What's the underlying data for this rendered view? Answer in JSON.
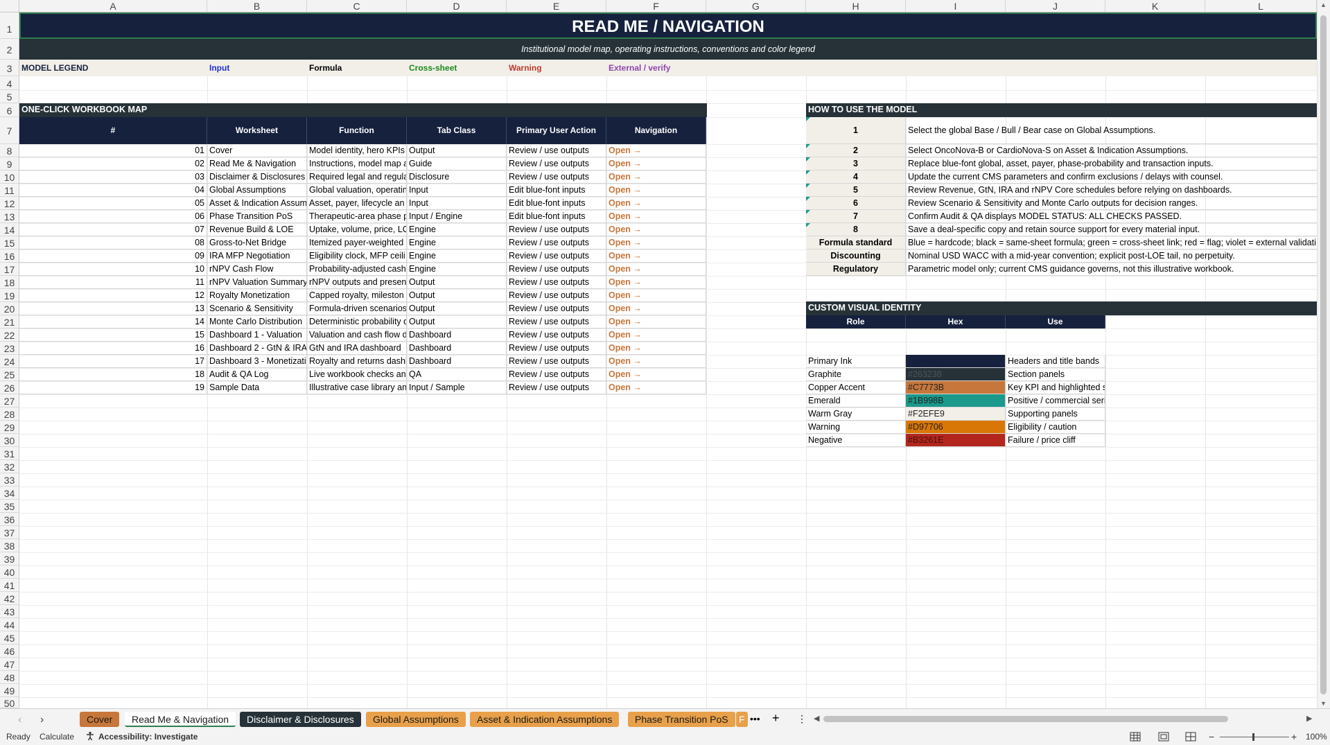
{
  "columns": [
    "A",
    "B",
    "C",
    "D",
    "E",
    "F",
    "G",
    "H",
    "I",
    "J",
    "K",
    "L"
  ],
  "rows": [
    "1",
    "2",
    "3",
    "4",
    "5",
    "6",
    "7",
    "8",
    "9",
    "10",
    "11",
    "12",
    "13",
    "14",
    "15",
    "16",
    "17",
    "18",
    "19",
    "20",
    "21",
    "22",
    "23",
    "24",
    "25",
    "26",
    "27",
    "28",
    "29",
    "30",
    "31",
    "32",
    "33",
    "34",
    "35",
    "36",
    "37",
    "38",
    "39",
    "40",
    "41",
    "42",
    "43",
    "44",
    "45",
    "46",
    "47",
    "48",
    "49",
    "50"
  ],
  "title": "READ ME / NAVIGATION",
  "subtitle": "Institutional model map, operating instructions, conventions and color legend",
  "legend": {
    "label": "MODEL LEGEND",
    "input": "Input",
    "formula": "Formula",
    "cross_sheet": "Cross-sheet",
    "warning": "Warning",
    "external": "External / verify",
    "colors": {
      "input": "#1f2fd1",
      "formula": "#000000",
      "cross_sheet": "#1a8a1a",
      "warning": "#c0392b",
      "external": "#8e44ad"
    }
  },
  "map": {
    "section_title": "ONE-CLICK WORKBOOK MAP",
    "headers": [
      "#",
      "Worksheet",
      "Function",
      "Tab Class",
      "Primary User Action",
      "Navigation"
    ],
    "rows": [
      {
        "n": "01",
        "sheet": "Cover",
        "func": "Model identity, hero KPIs",
        "cls": "Output",
        "action": "Review / use outputs",
        "nav": "Open →"
      },
      {
        "n": "02",
        "sheet": "Read Me & Navigation",
        "func": "Instructions, model map a",
        "cls": "Guide",
        "action": "Review / use outputs",
        "nav": "Open →"
      },
      {
        "n": "03",
        "sheet": "Disclaimer & Disclosures",
        "func": "Required legal and regula",
        "cls": "Disclosure",
        "action": "Review / use outputs",
        "nav": "Open →"
      },
      {
        "n": "04",
        "sheet": "Global Assumptions",
        "func": "Global valuation, operatin",
        "cls": "Input",
        "action": "Edit blue-font inputs",
        "nav": "Open →"
      },
      {
        "n": "05",
        "sheet": "Asset & Indication Assum",
        "func": "Asset, payer, lifecycle an",
        "cls": "Input",
        "action": "Edit blue-font inputs",
        "nav": "Open →"
      },
      {
        "n": "06",
        "sheet": "Phase Transition PoS",
        "func": "Therapeutic-area phase p",
        "cls": "Input / Engine",
        "action": "Edit blue-font inputs",
        "nav": "Open →"
      },
      {
        "n": "07",
        "sheet": "Revenue Build & LOE",
        "func": "Uptake, volume, price, LC",
        "cls": "Engine",
        "action": "Review / use outputs",
        "nav": "Open →"
      },
      {
        "n": "08",
        "sheet": "Gross-to-Net Bridge",
        "func": "Itemized payer-weighted g",
        "cls": "Engine",
        "action": "Review / use outputs",
        "nav": "Open →"
      },
      {
        "n": "09",
        "sheet": "IRA MFP Negotiation",
        "func": "Eligibility clock, MFP ceili",
        "cls": "Engine",
        "action": "Review / use outputs",
        "nav": "Open →"
      },
      {
        "n": "10",
        "sheet": "rNPV Cash Flow",
        "func": "Probability-adjusted cash",
        "cls": "Engine",
        "action": "Review / use outputs",
        "nav": "Open →"
      },
      {
        "n": "11",
        "sheet": "rNPV Valuation Summary",
        "func": "rNPV outputs and presen",
        "cls": "Output",
        "action": "Review / use outputs",
        "nav": "Open →"
      },
      {
        "n": "12",
        "sheet": "Royalty Monetization",
        "func": "Capped royalty, mileston",
        "cls": "Output",
        "action": "Review / use outputs",
        "nav": "Open →"
      },
      {
        "n": "13",
        "sheet": "Scenario & Sensitivity",
        "func": "Formula-driven scenarios",
        "cls": "Output",
        "action": "Review / use outputs",
        "nav": "Open →"
      },
      {
        "n": "14",
        "sheet": "Monte Carlo Distribution",
        "func": "Deterministic probability d",
        "cls": "Output",
        "action": "Review / use outputs",
        "nav": "Open →"
      },
      {
        "n": "15",
        "sheet": "Dashboard 1 - Valuation",
        "func": "Valuation and cash flow d",
        "cls": "Dashboard",
        "action": "Review / use outputs",
        "nav": "Open →"
      },
      {
        "n": "16",
        "sheet": "Dashboard 2 - GtN & IRA",
        "func": "GtN and IRA dashboard",
        "cls": "Dashboard",
        "action": "Review / use outputs",
        "nav": "Open →"
      },
      {
        "n": "17",
        "sheet": "Dashboard 3 - Monetizati",
        "func": "Royalty and returns dashb",
        "cls": "Dashboard",
        "action": "Review / use outputs",
        "nav": "Open →"
      },
      {
        "n": "18",
        "sheet": "Audit & QA Log",
        "func": "Live workbook checks an",
        "cls": "QA",
        "action": "Review / use outputs",
        "nav": "Open →"
      },
      {
        "n": "19",
        "sheet": "Sample Data",
        "func": "Illustrative case library an",
        "cls": "Input / Sample",
        "action": "Review / use outputs",
        "nav": "Open →"
      }
    ]
  },
  "how_to": {
    "section_title": "HOW TO USE THE MODEL",
    "steps": [
      {
        "k": "1",
        "text": "Select the global Base / Bull / Bear case on Global Assumptions."
      },
      {
        "k": "2",
        "text": "Select OncoNova-B or CardioNova-S on Asset & Indication Assumptions."
      },
      {
        "k": "3",
        "text": "Replace blue-font global, asset, payer, phase-probability and transaction inputs."
      },
      {
        "k": "4",
        "text": "Update the current CMS parameters and confirm exclusions / delays with counsel."
      },
      {
        "k": "5",
        "text": "Review Revenue, GtN, IRA and rNPV Core schedules before relying on dashboards."
      },
      {
        "k": "6",
        "text": "Review Scenario & Sensitivity and Monte Carlo outputs for decision ranges."
      },
      {
        "k": "7",
        "text": "Confirm Audit & QA displays MODEL STATUS: ALL CHECKS PASSED."
      },
      {
        "k": "8",
        "text": "Save a deal-specific copy and retain source support for every material input."
      },
      {
        "k": "Formula standard",
        "text": "Blue = hardcode; black = same-sheet formula; green = cross-sheet link; red = flag; violet = external validati"
      },
      {
        "k": "Discounting",
        "text": "Nominal USD WACC with a mid-year convention; explicit post-LOE tail, no perpetuity."
      },
      {
        "k": "Regulatory",
        "text": "Parametric model only; current CMS guidance governs, not this illustrative workbook."
      }
    ]
  },
  "identity": {
    "section_title": "CUSTOM VISUAL IDENTITY",
    "headers": [
      "Role",
      "Hex",
      "Use"
    ],
    "rows": [
      {
        "role": "Primary Ink",
        "hex": "#16213E",
        "use": "Headers and title bands",
        "color": "#16213e",
        "fg": "#16213e"
      },
      {
        "role": "Graphite",
        "hex": "#263238",
        "use": "Section panels",
        "color": "#263238",
        "fg": "#4a565c"
      },
      {
        "role": "Copper Accent",
        "hex": "#C7773B",
        "use": "Key KPI and highlighted series",
        "color": "#c7773b",
        "fg": "#222222"
      },
      {
        "role": "Emerald",
        "hex": "#1B998B",
        "use": "Positive / commercial series",
        "color": "#1b998b",
        "fg": "#222222"
      },
      {
        "role": "Warm Gray",
        "hex": "#F2EFE9",
        "use": "Supporting panels",
        "color": "#f2efe9",
        "fg": "#222222"
      },
      {
        "role": "Warning",
        "hex": "#D97706",
        "use": "Eligibility / caution",
        "color": "#d97706",
        "fg": "#222222"
      },
      {
        "role": "Negative",
        "hex": "#B3261E",
        "use": "Failure / price cliff",
        "color": "#b3261e",
        "fg": "#4a0f0c"
      }
    ]
  },
  "tabs": [
    {
      "label": "Cover",
      "bg": "#c7773b",
      "fg": "#1a1a1a",
      "active": false
    },
    {
      "label": "Read Me & Navigation",
      "bg": "#ffffff",
      "fg": "#1a1a1a",
      "active": true
    },
    {
      "label": "Disclaimer & Disclosures",
      "bg": "#263238",
      "fg": "#ffffff",
      "active": false
    },
    {
      "label": "Global Assumptions",
      "bg": "#e8a04a",
      "fg": "#1a1a1a",
      "active": false
    },
    {
      "label": "Asset & Indication Assumptions",
      "bg": "#e8a04a",
      "fg": "#1a1a1a",
      "active": false
    },
    {
      "label": "Phase Transition PoS",
      "bg": "#e8a04a",
      "fg": "#1a1a1a",
      "active": false
    },
    {
      "label": "F",
      "bg": "#e8a04a",
      "fg": "#ffffff",
      "active": false
    }
  ],
  "tab_controls": {
    "more": "•••",
    "add": "+",
    "options": "⋮"
  },
  "status": {
    "ready": "Ready",
    "calculate": "Calculate",
    "accessibility": "Accessibility: Investigate",
    "zoom": "100%"
  }
}
